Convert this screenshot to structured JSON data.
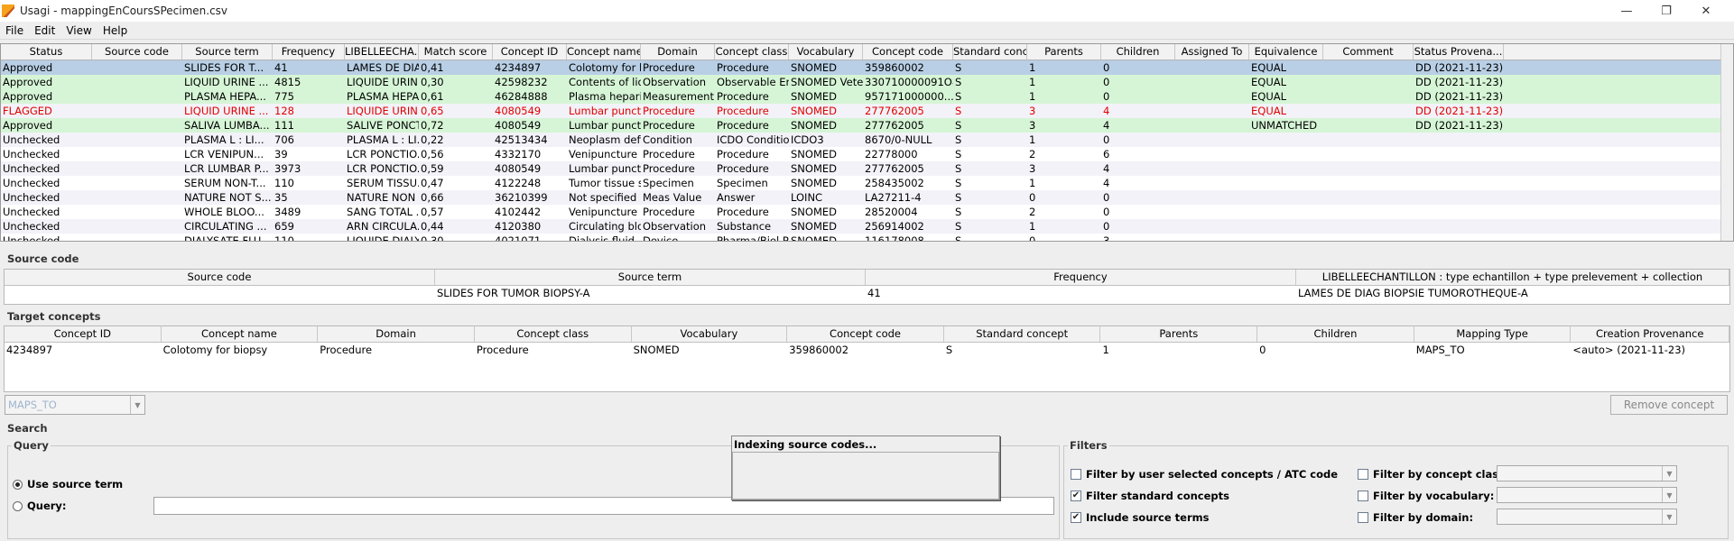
{
  "window": {
    "title": "Usagi - mappingEnCoursSPecimen.csv"
  },
  "menu": [
    {
      "label": "File"
    },
    {
      "label": "Edit"
    },
    {
      "label": "View"
    },
    {
      "label": "Help"
    }
  ],
  "grid": {
    "columns": [
      "Status",
      "Source code",
      "Source term",
      "Frequency",
      "LIBELLEECHA...",
      "Match score",
      "Concept ID",
      "Concept name",
      "Domain",
      "Concept class",
      "Vocabulary",
      "Concept code",
      "Standard concept",
      "Parents",
      "Children",
      "Assigned To",
      "Equivalence",
      "Comment",
      "Status Provena..."
    ],
    "rows": [
      {
        "kind": "sel",
        "cells": [
          "Approved",
          "",
          "SLIDES FOR T...",
          "41",
          "LAMES DE DIA...",
          "0,41",
          "4234897",
          "Colotomy for bio...",
          "Procedure",
          "Procedure",
          "SNOMED",
          "359860002",
          "S",
          "1",
          "0",
          "",
          "EQUAL",
          "",
          "DD (2021-11-23)"
        ]
      },
      {
        "kind": "app",
        "cells": [
          "Approved",
          "",
          "LIQUID URINE ...",
          "4815",
          "LIQUIDE URINE...",
          "0,30",
          "42598232",
          "Contents of liqui...",
          "Observation",
          "Observable Entity",
          "SNOMED Veteri...",
          "330710000091O8",
          "S",
          "1",
          "0",
          "",
          "EQUAL",
          "",
          "DD (2021-11-23)"
        ]
      },
      {
        "kind": "app",
        "cells": [
          "Approved",
          "",
          "PLASMA HEPA...",
          "775",
          "PLASMA HEPA...",
          "0,61",
          "46284888",
          "Plasma heparin...",
          "Measurement",
          "Procedure",
          "SNOMED",
          "957171000000...",
          "S",
          "1",
          "0",
          "",
          "EQUAL",
          "",
          "DD (2021-11-23)"
        ]
      },
      {
        "kind": "flag",
        "cells": [
          "FLAGGED",
          "",
          "LIQUID URINE ...",
          "128",
          "LIQUIDE URINE...",
          "0,65",
          "4080549",
          "Lumbar puncture",
          "Procedure",
          "Procedure",
          "SNOMED",
          "277762005",
          "S",
          "3",
          "4",
          "",
          "EQUAL",
          "",
          "DD (2021-11-23)"
        ]
      },
      {
        "kind": "app",
        "cells": [
          "Approved",
          "",
          "SALIVA LUMBA...",
          "111",
          "SALIVE PONCTI...",
          "0,72",
          "4080549",
          "Lumbar puncture",
          "Procedure",
          "Procedure",
          "SNOMED",
          "277762005",
          "S",
          "3",
          "4",
          "",
          "UNMATCHED",
          "",
          "DD (2021-11-23)"
        ]
      },
      {
        "kind": "unc alt",
        "cells": [
          "Unchecked",
          "",
          "PLASMA L : LI...",
          "706",
          "PLASMA L : LI...",
          "0,22",
          "42513434",
          "Neoplasm defin...",
          "Condition",
          "ICDO Condition",
          "ICDO3",
          "8670/0-NULL",
          "S",
          "1",
          "0",
          "",
          "",
          "",
          ""
        ]
      },
      {
        "kind": "unc",
        "cells": [
          "Unchecked",
          "",
          "LCR VENIPUN...",
          "39",
          "LCR PONCTIO...",
          "0,56",
          "4332170",
          "Venipuncture",
          "Procedure",
          "Procedure",
          "SNOMED",
          "22778000",
          "S",
          "2",
          "6",
          "",
          "",
          "",
          ""
        ]
      },
      {
        "kind": "unc alt",
        "cells": [
          "Unchecked",
          "",
          "LCR LUMBAR P...",
          "3973",
          "LCR PONCTIO...",
          "0,59",
          "4080549",
          "Lumbar puncture",
          "Procedure",
          "Procedure",
          "SNOMED",
          "277762005",
          "S",
          "3",
          "4",
          "",
          "",
          "",
          ""
        ]
      },
      {
        "kind": "unc",
        "cells": [
          "Unchecked",
          "",
          "SERUM NON-T...",
          "110",
          "SERUM TISSU...",
          "0,47",
          "4122248",
          "Tumor tissue s...",
          "Specimen",
          "Specimen",
          "SNOMED",
          "258435002",
          "S",
          "1",
          "4",
          "",
          "",
          "",
          ""
        ]
      },
      {
        "kind": "unc alt",
        "cells": [
          "Unchecked",
          "",
          "NATURE NOT S...",
          "35",
          "NATURE NON ...",
          "0,66",
          "36210399",
          "Not specified",
          "Meas Value",
          "Answer",
          "LOINC",
          "LA27211-4",
          "S",
          "0",
          "0",
          "",
          "",
          "",
          ""
        ]
      },
      {
        "kind": "unc",
        "cells": [
          "Unchecked",
          "",
          "WHOLE BLOO...",
          "3489",
          "SANG TOTAL ...",
          "0,57",
          "4102442",
          "Venipuncture for...",
          "Procedure",
          "Procedure",
          "SNOMED",
          "28520004",
          "S",
          "2",
          "0",
          "",
          "",
          "",
          ""
        ]
      },
      {
        "kind": "unc alt",
        "cells": [
          "Unchecked",
          "",
          "CIRCULATING ...",
          "659",
          "ARN CIRCULA...",
          "0,44",
          "4120380",
          "Circulating blood",
          "Observation",
          "Substance",
          "SNOMED",
          "256914002",
          "S",
          "1",
          "0",
          "",
          "",
          "",
          ""
        ]
      },
      {
        "kind": "unc",
        "cells": [
          "Unchecked",
          "",
          "DIALYSATE FLU...",
          "110",
          "LIQUIDE DIALY...",
          "0,30",
          "4021071",
          "Dialysis fluid",
          "Device",
          "Pharma/Biol Pr...",
          "SNOMED",
          "116178008",
          "S",
          "0",
          "3",
          "",
          "",
          "",
          ""
        ]
      }
    ]
  },
  "source_code": {
    "label": "Source code",
    "columns": [
      "Source code",
      "Source term",
      "Frequency",
      "LIBELLEECHANTILLON : type echantillon +  type prelevement + collection"
    ],
    "row": [
      "",
      "SLIDES FOR TUMOR BIOPSY-A",
      "41",
      "LAMES DE DIAG BIOPSIE TUMOROTHEQUE-A"
    ]
  },
  "target_concepts": {
    "label": "Target concepts",
    "columns": [
      "Concept ID",
      "Concept name",
      "Domain",
      "Concept class",
      "Vocabulary",
      "Concept code",
      "Standard concept",
      "Parents",
      "Children",
      "Mapping Type",
      "Creation Provenance"
    ],
    "row": [
      "4234897",
      "Colotomy for biopsy",
      "Procedure",
      "Procedure",
      "SNOMED",
      "359860002",
      "S",
      "1",
      "0",
      "MAPS_TO",
      "<auto> (2021-11-23)"
    ]
  },
  "mapping_type_combo": {
    "value": "MAPS_TO"
  },
  "remove_button": {
    "label": "Remove concept"
  },
  "search": {
    "label": "Search",
    "query_group": "Query",
    "use_source_term": "Use source term",
    "query_label": "Query:",
    "query_value": ""
  },
  "indexing_popup": {
    "title": "Indexing source codes..."
  },
  "filters": {
    "label": "Filters",
    "user_selected": {
      "label": "Filter by user selected concepts / ATC code",
      "checked": false
    },
    "standard": {
      "label": "Filter standard concepts",
      "checked": true
    },
    "include_source": {
      "label": "Include source terms",
      "checked": true
    },
    "concept_class": {
      "label": "Filter by concept class:",
      "checked": false
    },
    "vocabulary": {
      "label": "Filter by vocabulary:",
      "checked": false
    },
    "domain": {
      "label": "Filter by domain:",
      "checked": false
    }
  }
}
